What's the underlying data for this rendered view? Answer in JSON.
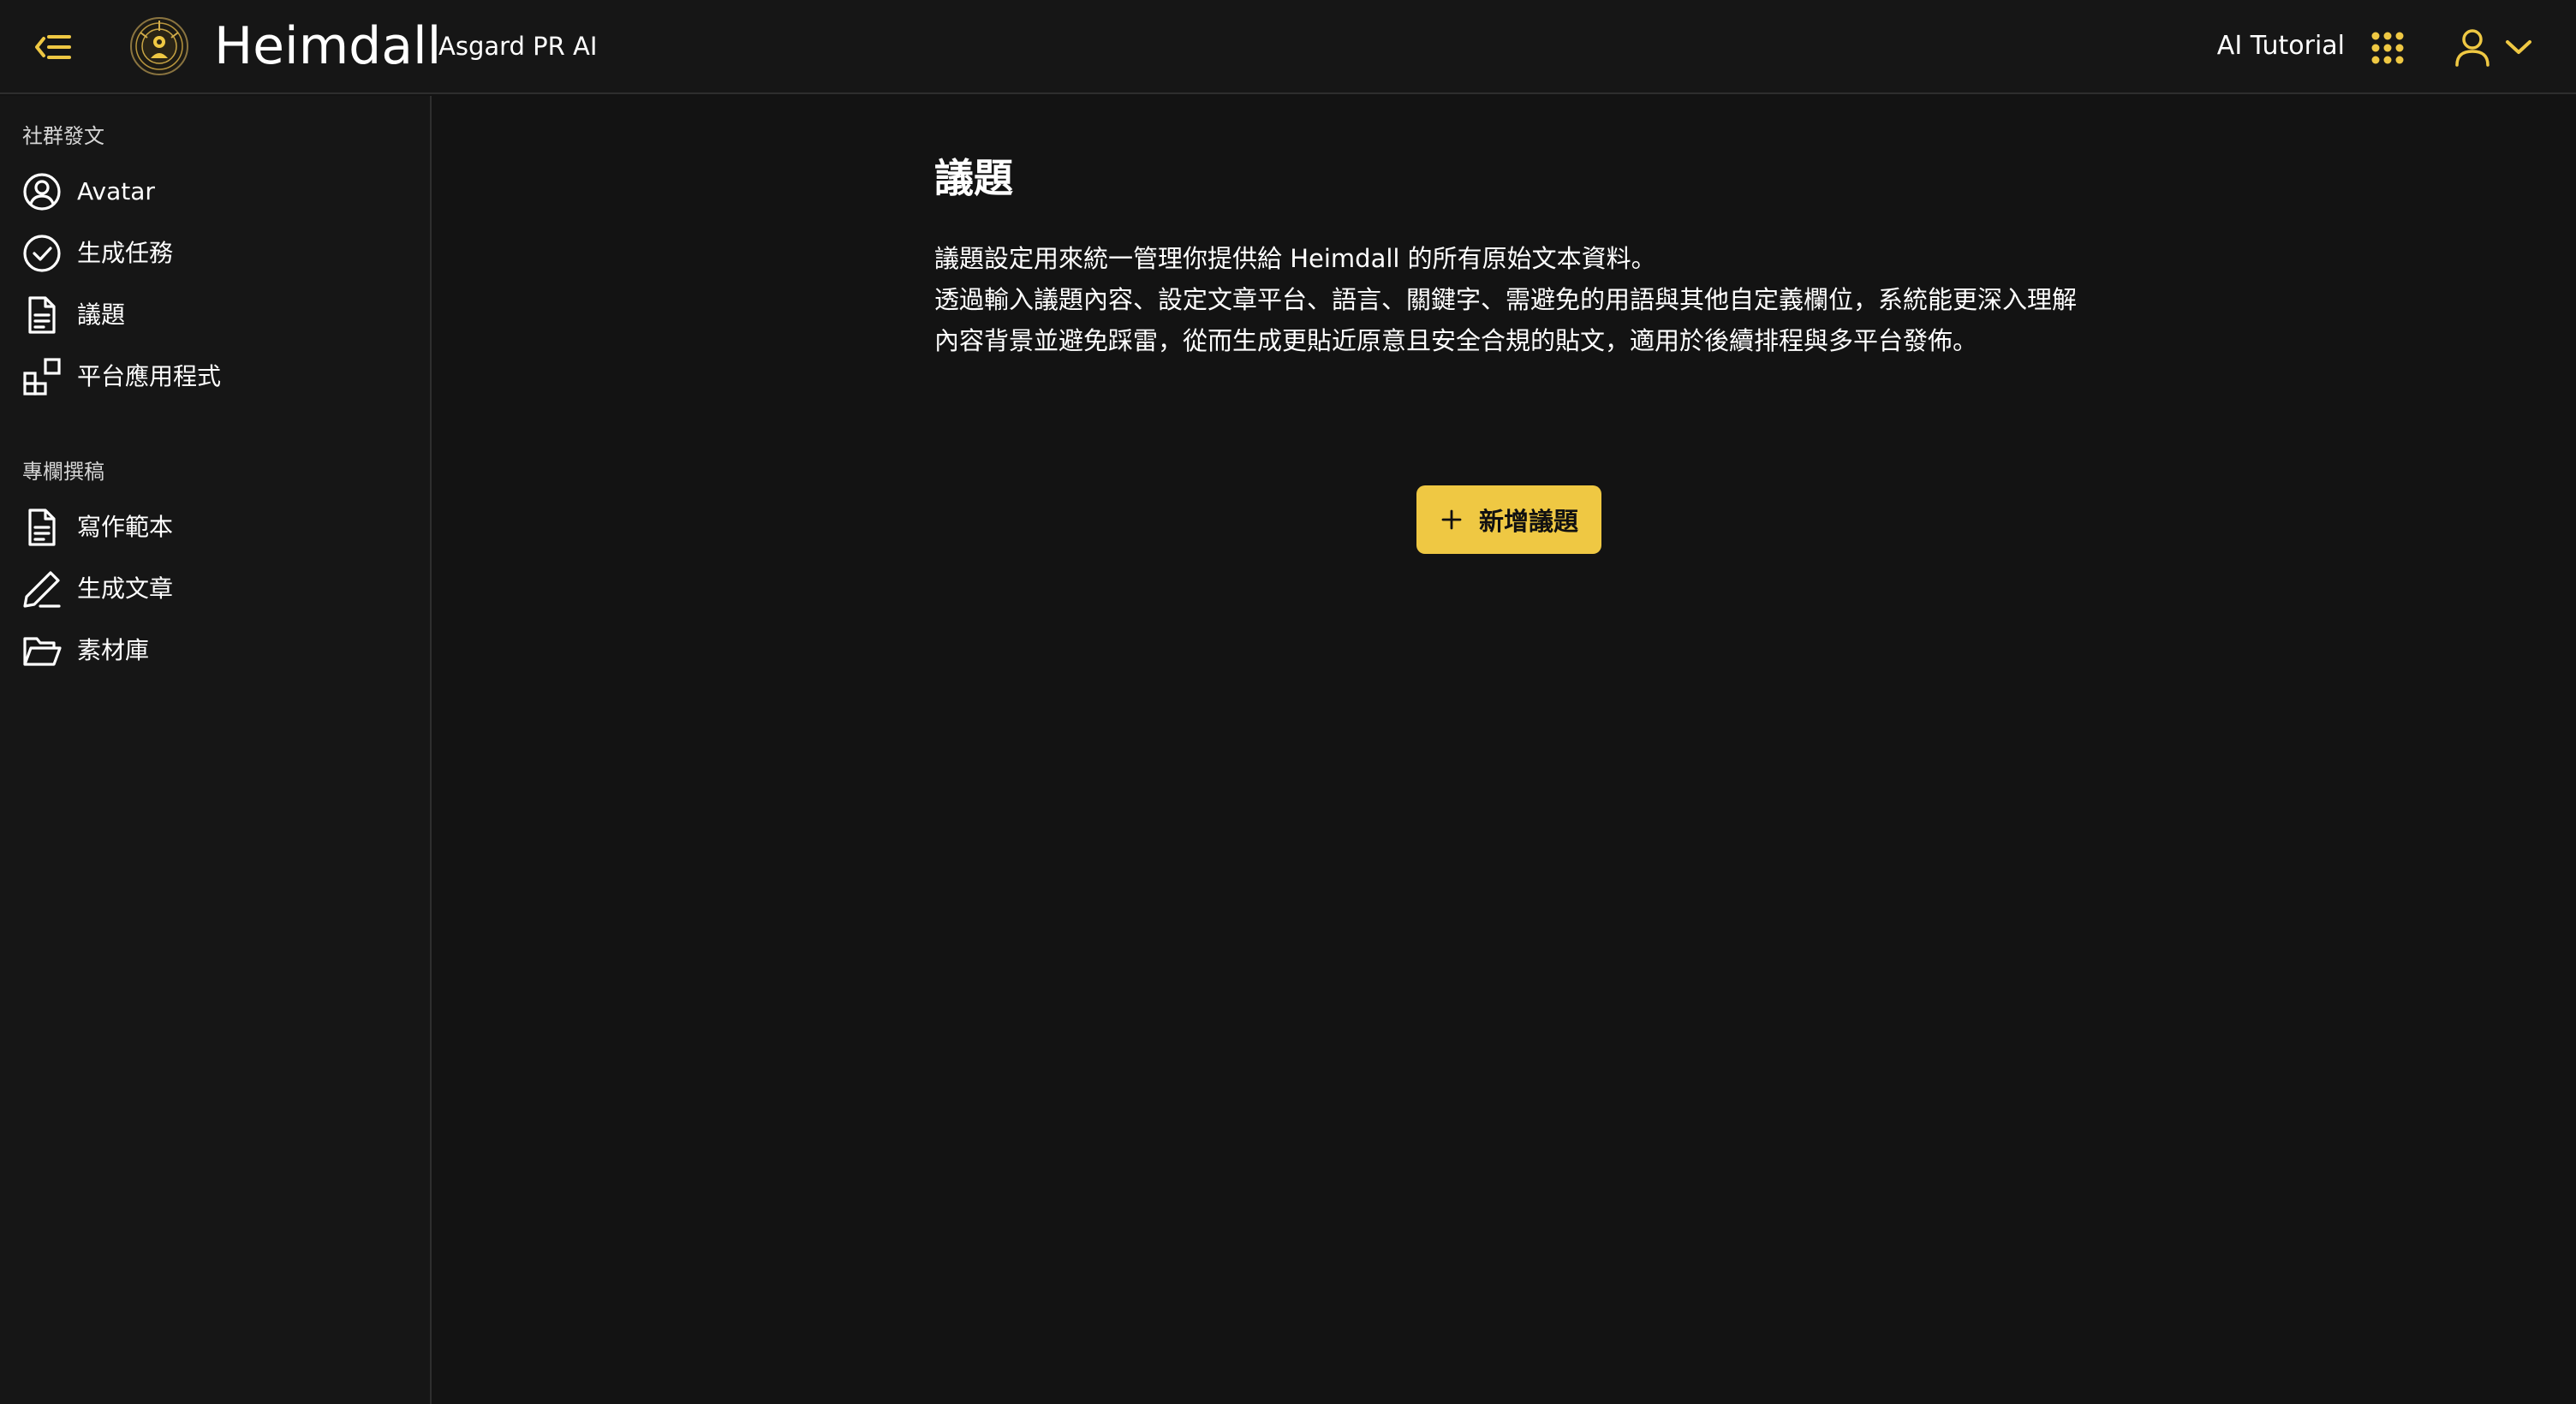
{
  "header": {
    "brand_name": "Heimdall",
    "brand_sub": "Asgard PR AI",
    "tutorial_label": "AI Tutorial",
    "accent_color": "#efc843",
    "icons": {
      "collapse": "collapse-sidebar-icon",
      "logo": "heimdall-logo",
      "apps": "apps-grid-icon",
      "user": "user-icon",
      "chevron": "chevron-down-icon"
    }
  },
  "sidebar": {
    "sections": [
      {
        "title": "社群發文",
        "items": [
          {
            "label": "Avatar",
            "icon": "user-circle-icon"
          },
          {
            "label": "生成任務",
            "icon": "check-circle-icon"
          },
          {
            "label": "議題",
            "icon": "document-icon"
          },
          {
            "label": "平台應用程式",
            "icon": "apps-blocks-icon"
          }
        ]
      },
      {
        "title": "專欄撰稿",
        "items": [
          {
            "label": "寫作範本",
            "icon": "document-icon"
          },
          {
            "label": "生成文章",
            "icon": "pencil-icon"
          },
          {
            "label": "素材庫",
            "icon": "folder-open-icon"
          }
        ]
      }
    ]
  },
  "main": {
    "title": "議題",
    "description_line1": "議題設定用來統一管理你提供給 Heimdall 的所有原始文本資料。",
    "description_line2": "透過輸入議題內容、設定文章平台、語言、關鍵字、需避免的用語與其他自定義欄位，系統能更深入理解內容背景並避免踩雷，從而生成更貼近原意且安全合規的貼文，適用於後續排程與多平台發佈。",
    "add_button_label": "新增議題",
    "add_button_icon": "plus-icon"
  }
}
